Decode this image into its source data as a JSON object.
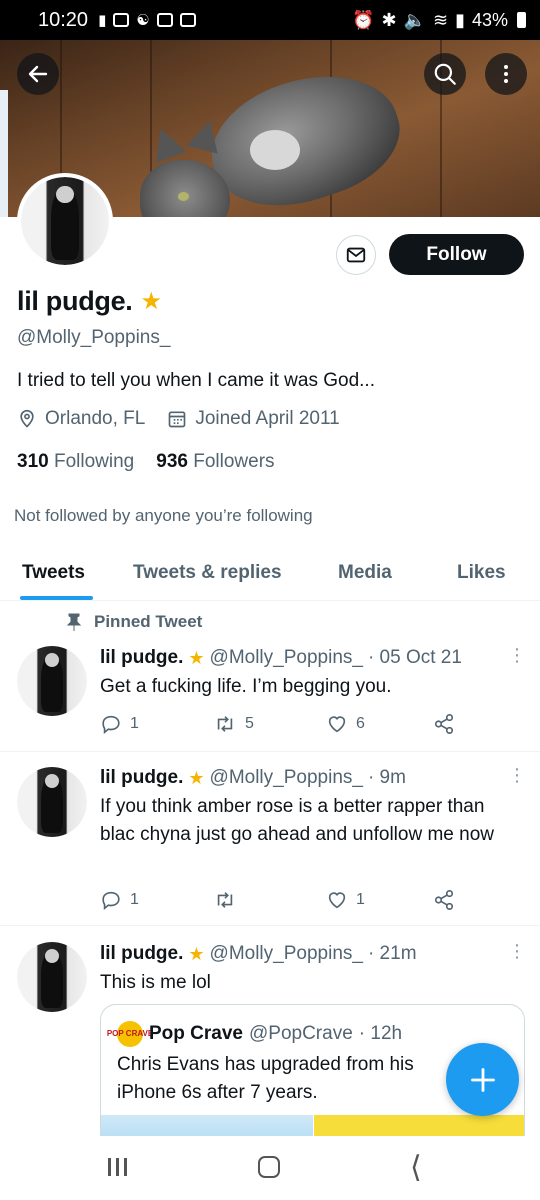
{
  "status_bar": {
    "time": "10:20",
    "battery": "43%"
  },
  "profile": {
    "display_name": "lil pudge.",
    "handle": "@Molly_Poppins_",
    "bio": "I tried to tell you when I came it was God...",
    "location": "Orlando, FL",
    "joined": "Joined April 2011",
    "following_count": "310",
    "following_label": "Following",
    "followers_count": "936",
    "followers_label": "Followers",
    "not_followed_text": "Not followed by anyone you’re following",
    "follow_button": "Follow"
  },
  "tabs": [
    {
      "label": "Tweets",
      "active": true
    },
    {
      "label": "Tweets & replies",
      "active": false
    },
    {
      "label": "Media",
      "active": false
    },
    {
      "label": "Likes",
      "active": false
    }
  ],
  "tweets": [
    {
      "pinned_label": "Pinned Tweet",
      "name": "lil pudge.",
      "handle": "@Molly_Poppins_",
      "time": "· 05 Oct 21",
      "text": "Get a fucking life. I’m begging you.",
      "replies": "1",
      "retweets": "5",
      "likes": "6"
    },
    {
      "name": "lil pudge.",
      "handle": "@Molly_Poppins_",
      "time": "· 9m",
      "text": "If you think amber rose is a better rapper than blac chyna just go ahead and unfollow me now",
      "replies": "1",
      "retweets": "",
      "likes": "1"
    },
    {
      "name": "lil pudge.",
      "handle": "@Molly_Poppins_",
      "time": "· 21m",
      "text": "This is me lol",
      "quote": {
        "logo_text": "POP CRAVE",
        "name": "Pop Crave",
        "handle": "@PopCrave",
        "time": "· 12h",
        "text": "Chris Evans has upgraded from his iPhone 6s after 7 years."
      }
    }
  ],
  "colors": {
    "accent": "#1d9bf0",
    "text_primary": "#0f1419",
    "text_secondary": "#536471",
    "follow_button_bg": "#0f1419"
  },
  "icons": [
    "arrow-left-icon",
    "search-icon",
    "more-vertical-icon",
    "mail-icon",
    "location-pin-icon",
    "calendar-icon",
    "pin-icon",
    "reply-icon",
    "retweet-icon",
    "like-icon",
    "share-icon",
    "plus-icon"
  ]
}
